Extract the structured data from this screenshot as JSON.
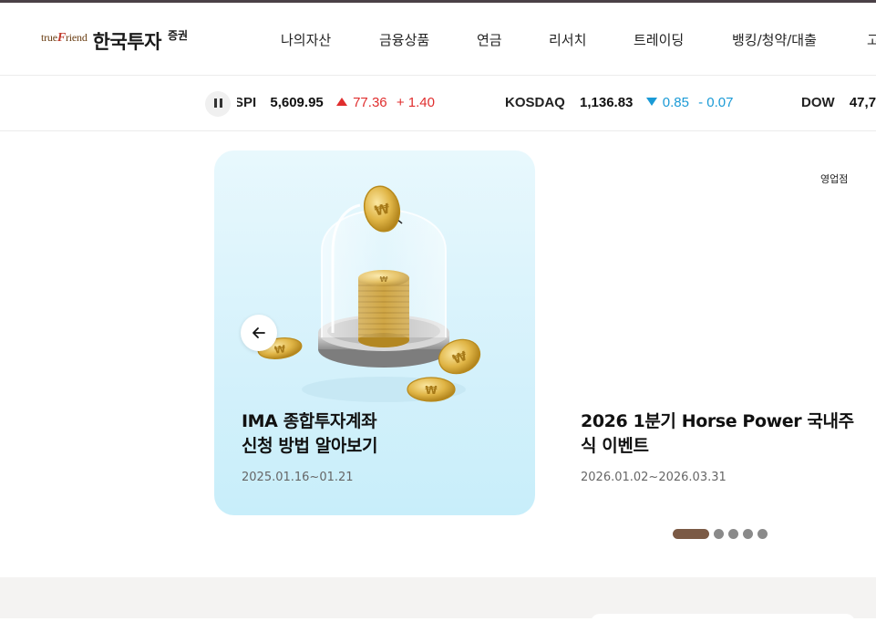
{
  "brand": {
    "tagline_prefix": "true",
    "tagline_f": "F",
    "tagline_suffix": "riend",
    "name": "한국투자",
    "suffix": "증권"
  },
  "nav": {
    "items": [
      "나의자산",
      "금융상품",
      "연금",
      "리서치",
      "트레이딩",
      "뱅킹/청약/대출",
      "고"
    ]
  },
  "ticker": {
    "pause_icon": "pause-icon",
    "items": [
      {
        "name": "SPI",
        "value": "5,609.95",
        "direction": "up",
        "change": "77.36",
        "rate": "+ 1.40"
      },
      {
        "name": "KOSDAQ",
        "value": "1,136.83",
        "direction": "down",
        "change": "0.85",
        "rate": "- 0.07"
      },
      {
        "name": "DOW",
        "value": "47,7"
      }
    ],
    "up_color": "#e02e2e",
    "down_color": "#1a9ad6"
  },
  "banner": {
    "prev_icon": "arrow-left-icon",
    "cards": [
      {
        "title_line1": "IMA 종합투자계좌",
        "title_line2": "신청 방법 알아보기",
        "date": "2025.01.16~01.21",
        "image": "coin-jar-illustration"
      },
      {
        "title_line1": "2026 1분기 Horse Power 국내주",
        "title_line2": "식 이벤트",
        "date": "2026.01.02~2026.03.31"
      }
    ],
    "branch_link": "영업점",
    "pagination": {
      "total": 5,
      "active": 1
    },
    "accent": "#7b5a45"
  }
}
